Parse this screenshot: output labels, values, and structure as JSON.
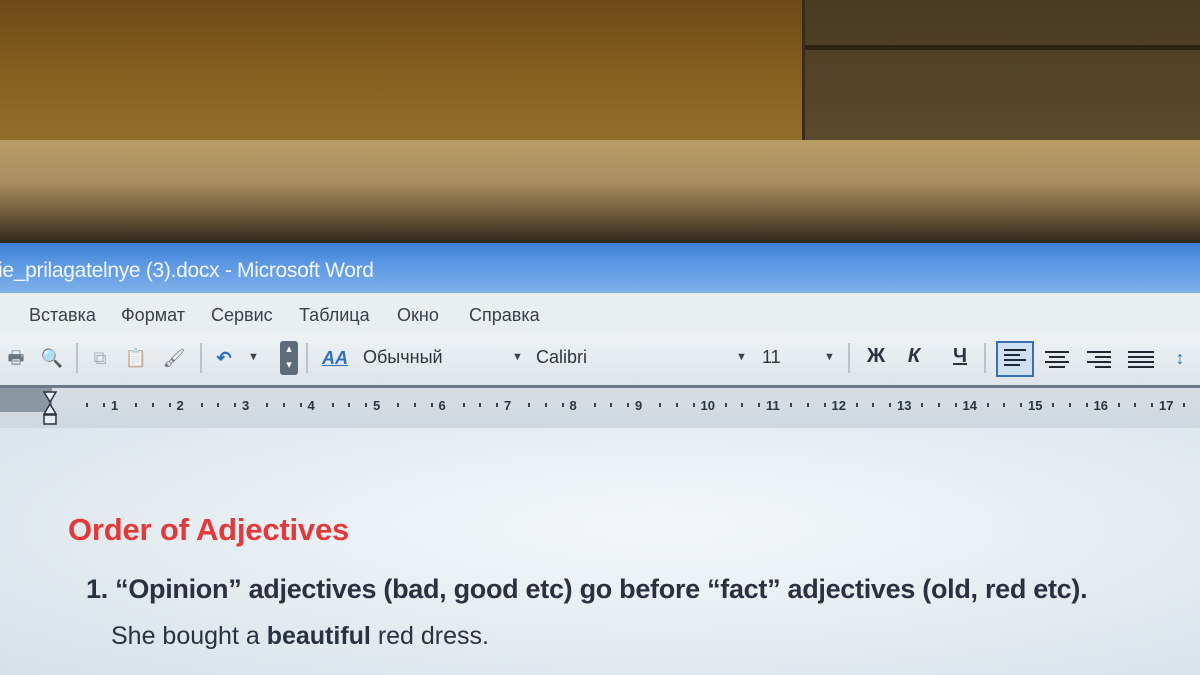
{
  "window": {
    "title": "ie_prilagatelnye (3).docx - Microsoft Word"
  },
  "menu": {
    "items": [
      "Вставка",
      "Формат",
      "Сервис",
      "Таблица",
      "Окно",
      "Справка"
    ]
  },
  "toolbar": {
    "style_label": "Обычный",
    "font_name": "Calibri",
    "font_size": "11",
    "bold_label": "Ж",
    "italic_label": "К",
    "underline_label": "Ч"
  },
  "ruler": {
    "numbers": [
      "1",
      "2",
      "3",
      "4",
      "5",
      "6",
      "7",
      "8",
      "9",
      "10",
      "11",
      "12",
      "13",
      "14",
      "15",
      "16",
      "17"
    ]
  },
  "document": {
    "heading": "Order of Adjectives",
    "item_1": "1. “Opinion” adjectives (bad, good etc) go before “fact” adjectives (old, red etc).",
    "example_prefix": "She bought a ",
    "example_bold": "beautiful",
    "example_suffix": " red dress."
  },
  "colors": {
    "heading": "#e23a3a",
    "titlebar": "#4a89dc",
    "text": "#2a3140"
  }
}
